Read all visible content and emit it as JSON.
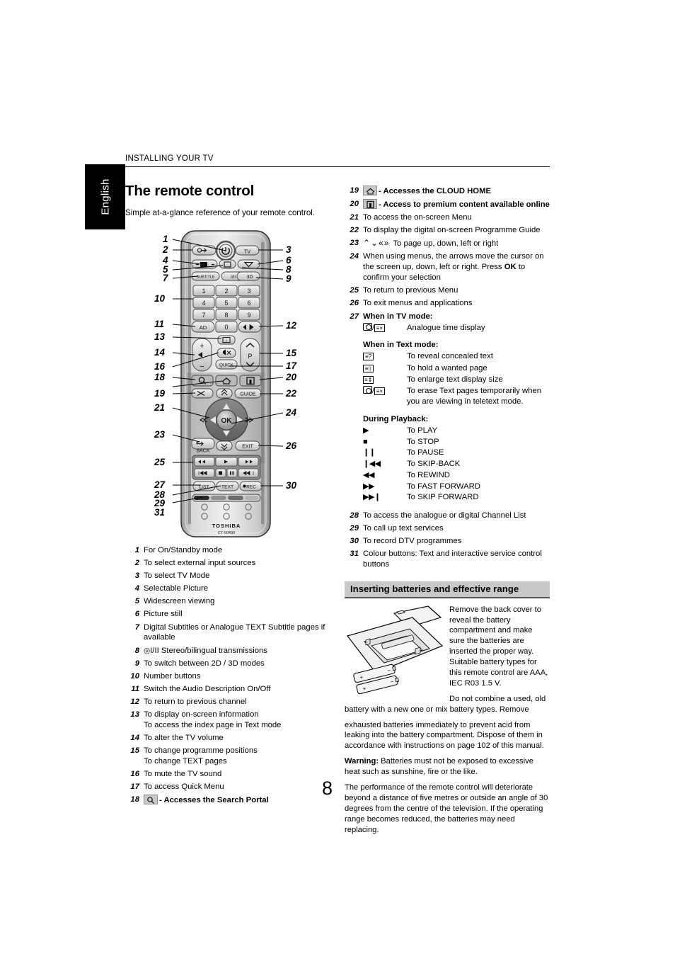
{
  "running_head": "INSTALLING YOUR TV",
  "language_tab": "English",
  "title": "The remote control",
  "subtitle": "Simple at-a-glance reference of your remote control.",
  "page_number": "8",
  "remote": {
    "brand": "TOSHIBA",
    "model": "CT-90430",
    "buttons": {
      "tv": "TV",
      "subtitle": "SUBTITLE",
      "stereo": "I/II",
      "three_d": "3D",
      "ad": "AD",
      "p": "P",
      "quick": "QUICK",
      "guide": "GUIDE",
      "ok": "OK",
      "back": "BACK",
      "exit": "EXIT",
      "list": "LIST",
      "text": "TEXT",
      "rec": "REC",
      "plus": "+",
      "minus": "−",
      "keys": [
        "1",
        "2",
        "3",
        "4",
        "5",
        "6",
        "7",
        "8",
        "9",
        "0"
      ]
    },
    "callouts": [
      "1",
      "2",
      "3",
      "4",
      "5",
      "6",
      "7",
      "8",
      "9",
      "10",
      "11",
      "12",
      "13",
      "14",
      "15",
      "16",
      "17",
      "18",
      "19",
      "20",
      "21",
      "22",
      "23",
      "24",
      "25",
      "26",
      "27",
      "28",
      "29",
      "30",
      "31"
    ]
  },
  "left_items": [
    {
      "num": "1",
      "text": "For On/Standby mode"
    },
    {
      "num": "2",
      "text": "To select external input sources"
    },
    {
      "num": "3",
      "text": "To select TV Mode"
    },
    {
      "num": "4",
      "text": "Selectable Picture"
    },
    {
      "num": "5",
      "text": "Widescreen viewing"
    },
    {
      "num": "6",
      "text": "Picture still"
    },
    {
      "num": "7",
      "text": "Digital Subtitles or Analogue TEXT Subtitle pages if available"
    },
    {
      "num": "8",
      "text": "I/II Stereo/bilingual transmissions",
      "prefix_glyph": "stereo"
    },
    {
      "num": "9",
      "text": "To switch between 2D / 3D modes"
    },
    {
      "num": "10",
      "text": "Number buttons"
    },
    {
      "num": "11",
      "text": "Switch the Audio Description On/Off"
    },
    {
      "num": "12",
      "text": "To return to previous channel"
    },
    {
      "num": "13",
      "text": "To display on-screen information",
      "line2": "To access the index page in Text mode"
    },
    {
      "num": "14",
      "text": "To alter the TV volume"
    },
    {
      "num": "15",
      "text": "To change programme positions",
      "line2": "To change TEXT pages"
    },
    {
      "num": "16",
      "text": "To mute the TV sound"
    },
    {
      "num": "17",
      "text": "To access Quick Menu"
    },
    {
      "num": "18",
      "text": "- Accesses the Search Portal",
      "icon": "search-icon",
      "bold": true
    }
  ],
  "right_items_top": [
    {
      "num": "19",
      "text": "- Accesses the CLOUD HOME",
      "icon": "home-icon",
      "bold": true
    },
    {
      "num": "20",
      "text": "- Access to premium content available online",
      "icon": "portal-icon",
      "bold": true
    },
    {
      "num": "21",
      "text": "To access the on-screen Menu"
    },
    {
      "num": "22",
      "text": "To display the digital on-screen Programme Guide"
    },
    {
      "num": "23",
      "text": "To page up, down, left or right",
      "glyphs": "page-arrows"
    },
    {
      "num": "24",
      "text": "When using menus, the arrows move the cursor on the screen up, down, left or right. Press OK to confirm your selection",
      "bold_word": "OK"
    },
    {
      "num": "25",
      "text": "To return to previous Menu"
    },
    {
      "num": "26",
      "text": "To exit menus and applications"
    }
  ],
  "item27": {
    "num": "27",
    "tv_mode_heading": "When in TV mode:",
    "tv_mode_label": "Analogue time display",
    "text_mode_heading": "When in Text mode:",
    "text_mode_rows": [
      {
        "glyph": "reveal",
        "label": "To reveal concealed text"
      },
      {
        "glyph": "hold",
        "label": "To hold a wanted page"
      },
      {
        "glyph": "enlarge",
        "label": "To enlarge text display size"
      },
      {
        "glyph": "erase",
        "label": "To erase Text pages temporarily when you are viewing in teletext mode."
      }
    ],
    "playback_heading": "During Playback:",
    "playback_rows": [
      {
        "glyph": "▶",
        "label": "To PLAY"
      },
      {
        "glyph": "■",
        "label": "To STOP"
      },
      {
        "glyph": "❙❙",
        "label": "To PAUSE"
      },
      {
        "glyph": "❙◀◀",
        "label": "To SKIP-BACK"
      },
      {
        "glyph": "◀◀",
        "label": "To REWIND"
      },
      {
        "glyph": "▶▶",
        "label": "To FAST FORWARD"
      },
      {
        "glyph": "▶▶❙",
        "label": "To SKIP FORWARD"
      }
    ]
  },
  "right_items_bottom": [
    {
      "num": "28",
      "text": "To access the analogue or digital Channel List"
    },
    {
      "num": "29",
      "text": "To call up text services"
    },
    {
      "num": "30",
      "text": "To record DTV programmes"
    },
    {
      "num": "31",
      "text": "Colour buttons: Text and interactive service control buttons"
    }
  ],
  "batteries": {
    "heading": "Inserting batteries and effective range",
    "p1": "Remove the back cover to reveal the battery compartment and make sure the batteries are inserted the proper way. Suitable battery types for this remote control are AAA, IEC R03 1.5 V.",
    "p2_head": "Do not combine a used, old battery with a new one or mix battery types. Remove",
    "p2_rest": "exhausted batteries immediately to prevent acid from leaking into the battery compartment. Dispose of them in accordance with instructions on page 102 of this manual.",
    "warning_label": "Warning:",
    "warning_text": " Batteries must not be exposed to excessive heat such as sunshine, fire or the like.",
    "p3": "The performance of the remote control will deteriorate beyond a distance of five metres or outside an angle of 30 degrees from the centre of the television. If the operating range becomes reduced, the batteries may need replacing."
  }
}
